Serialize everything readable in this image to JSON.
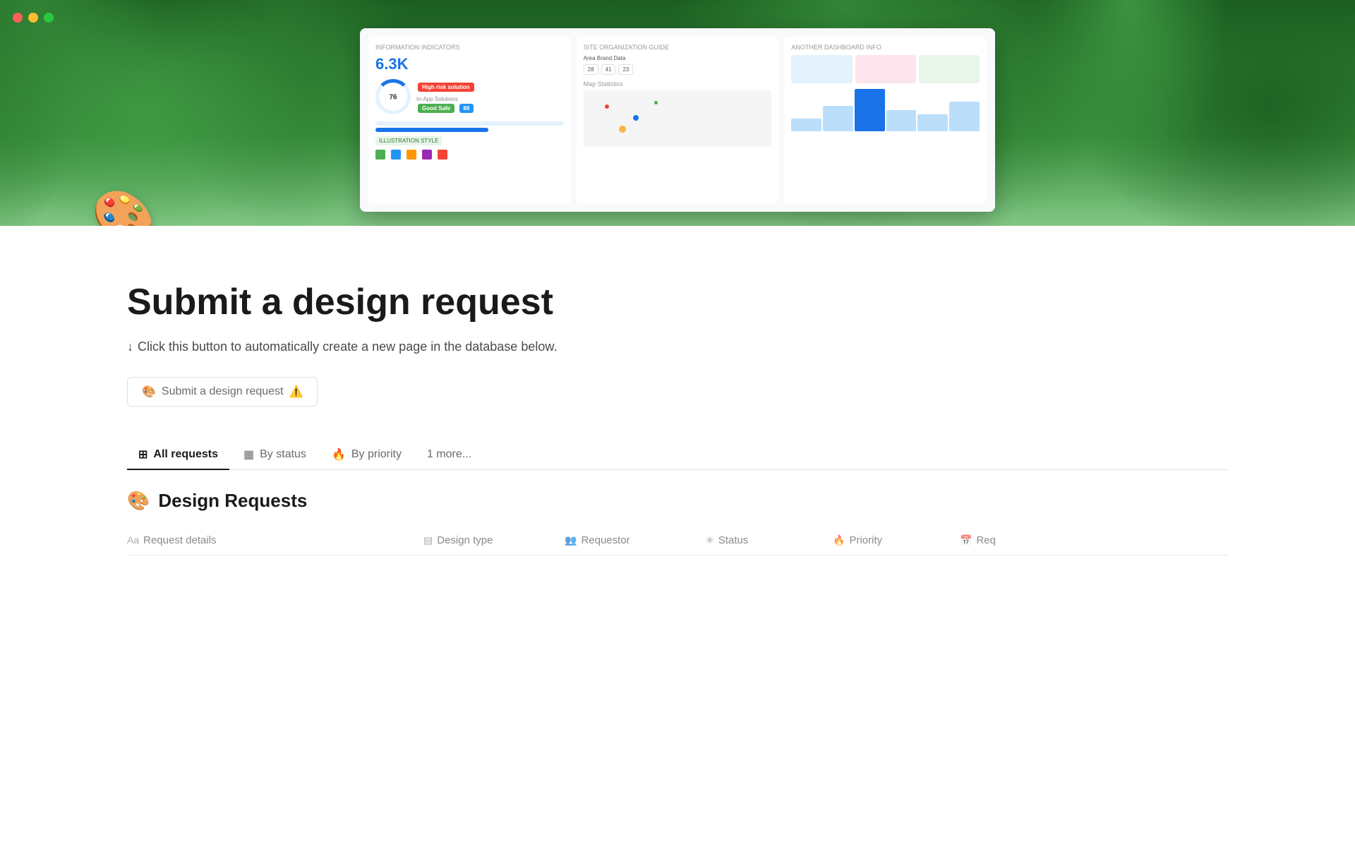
{
  "window": {
    "traffic_lights": [
      {
        "color": "#ff5f57",
        "name": "close"
      },
      {
        "color": "#febc2e",
        "name": "minimize"
      },
      {
        "color": "#28c840",
        "name": "maximize"
      }
    ]
  },
  "hero": {
    "palette_emoji": "🎨"
  },
  "content": {
    "title": "Submit a design request",
    "subtitle_arrow": "↓",
    "subtitle_text": "Click this button to automatically create a new page in the database below.",
    "submit_button": {
      "icon": "🎨",
      "label": "Submit a design request",
      "warning_icon": "⚠️"
    }
  },
  "tabs": [
    {
      "id": "all-requests",
      "icon": "⊞",
      "label": "All requests",
      "active": true
    },
    {
      "id": "by-status",
      "icon": "▦",
      "label": "By status",
      "active": false
    },
    {
      "id": "by-priority",
      "icon": "🔥",
      "label": "By priority",
      "active": false
    },
    {
      "id": "more",
      "icon": "",
      "label": "1 more...",
      "active": false
    }
  ],
  "section": {
    "icon": "🎨",
    "title": "Design Requests"
  },
  "table_columns": [
    {
      "id": "request-details",
      "icon": "Aa",
      "label": "Request details"
    },
    {
      "id": "design-type",
      "icon": "▤",
      "label": "Design type"
    },
    {
      "id": "requestor",
      "icon": "👥",
      "label": "Requestor"
    },
    {
      "id": "status",
      "icon": "✳",
      "label": "Status"
    },
    {
      "id": "priority",
      "icon": "🔥",
      "label": "Priority"
    },
    {
      "id": "req2",
      "icon": "📅",
      "label": "Req"
    }
  ],
  "detected": {
    "priority_label": "Priority",
    "by_priority_label": "By priority"
  }
}
